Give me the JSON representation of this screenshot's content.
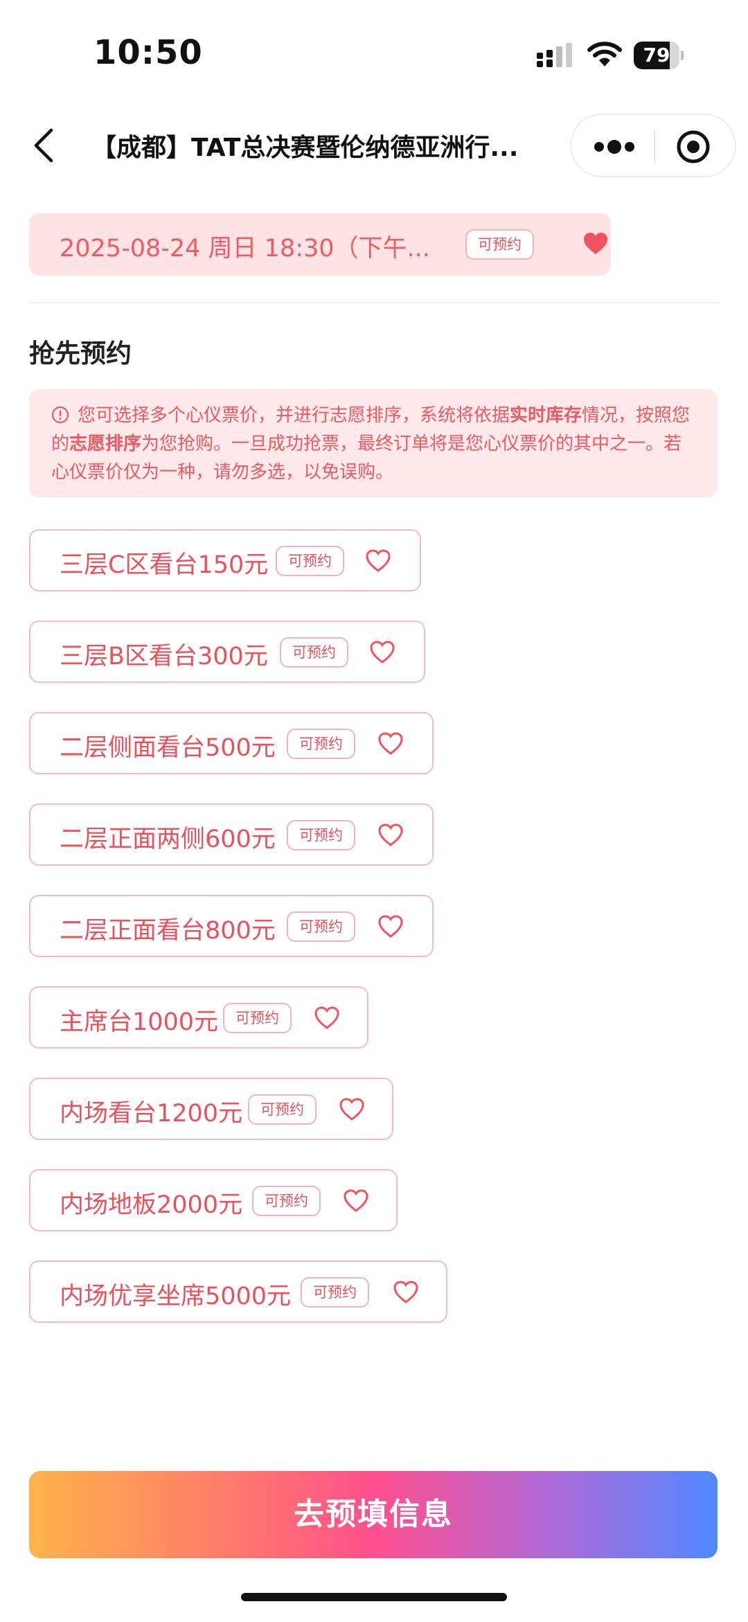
{
  "status_bar": {
    "time": "10:50",
    "battery": "79",
    "battery_level": 0.79
  },
  "nav": {
    "title": "【成都】TAT总决赛暨伦纳德亚洲行..."
  },
  "date_chip": {
    "text": "2025-08-24 周日 18:30（下午...",
    "badge": "可预约"
  },
  "section": {
    "title": "抢先预约"
  },
  "notice": {
    "part1": "您可选择多个心仪票价，并进行志愿排序，系统将依据",
    "bold1": "实时库存",
    "part2": "情况，按照您的",
    "bold2": "志愿排序",
    "part3": "为您抢购。一旦成功抢票，最终订单将是您心仪票价的其中之一。若心仪票价仅为一种，请勿多选，以免误购。"
  },
  "tickets": [
    {
      "label": "三层C区看台150元",
      "badge": "可预约"
    },
    {
      "label": "三层B区看台300元",
      "badge": "可预约"
    },
    {
      "label": "二层侧面看台500元",
      "badge": "可预约"
    },
    {
      "label": "二层正面两侧600元",
      "badge": "可预约"
    },
    {
      "label": "二层正面看台800元",
      "badge": "可预约"
    },
    {
      "label": "主席台1000元",
      "badge": "可预约"
    },
    {
      "label": "内场看台1200元",
      "badge": "可预约"
    },
    {
      "label": "内场地板2000元",
      "badge": "可预约"
    },
    {
      "label": "内场优享坐席5000元",
      "badge": "可预约"
    }
  ],
  "cta": {
    "label": "去预填信息"
  },
  "colors": {
    "accent": "#e9525c",
    "chip_bg": "#ffe3e5",
    "notice_bg": "#ffe9ea"
  }
}
